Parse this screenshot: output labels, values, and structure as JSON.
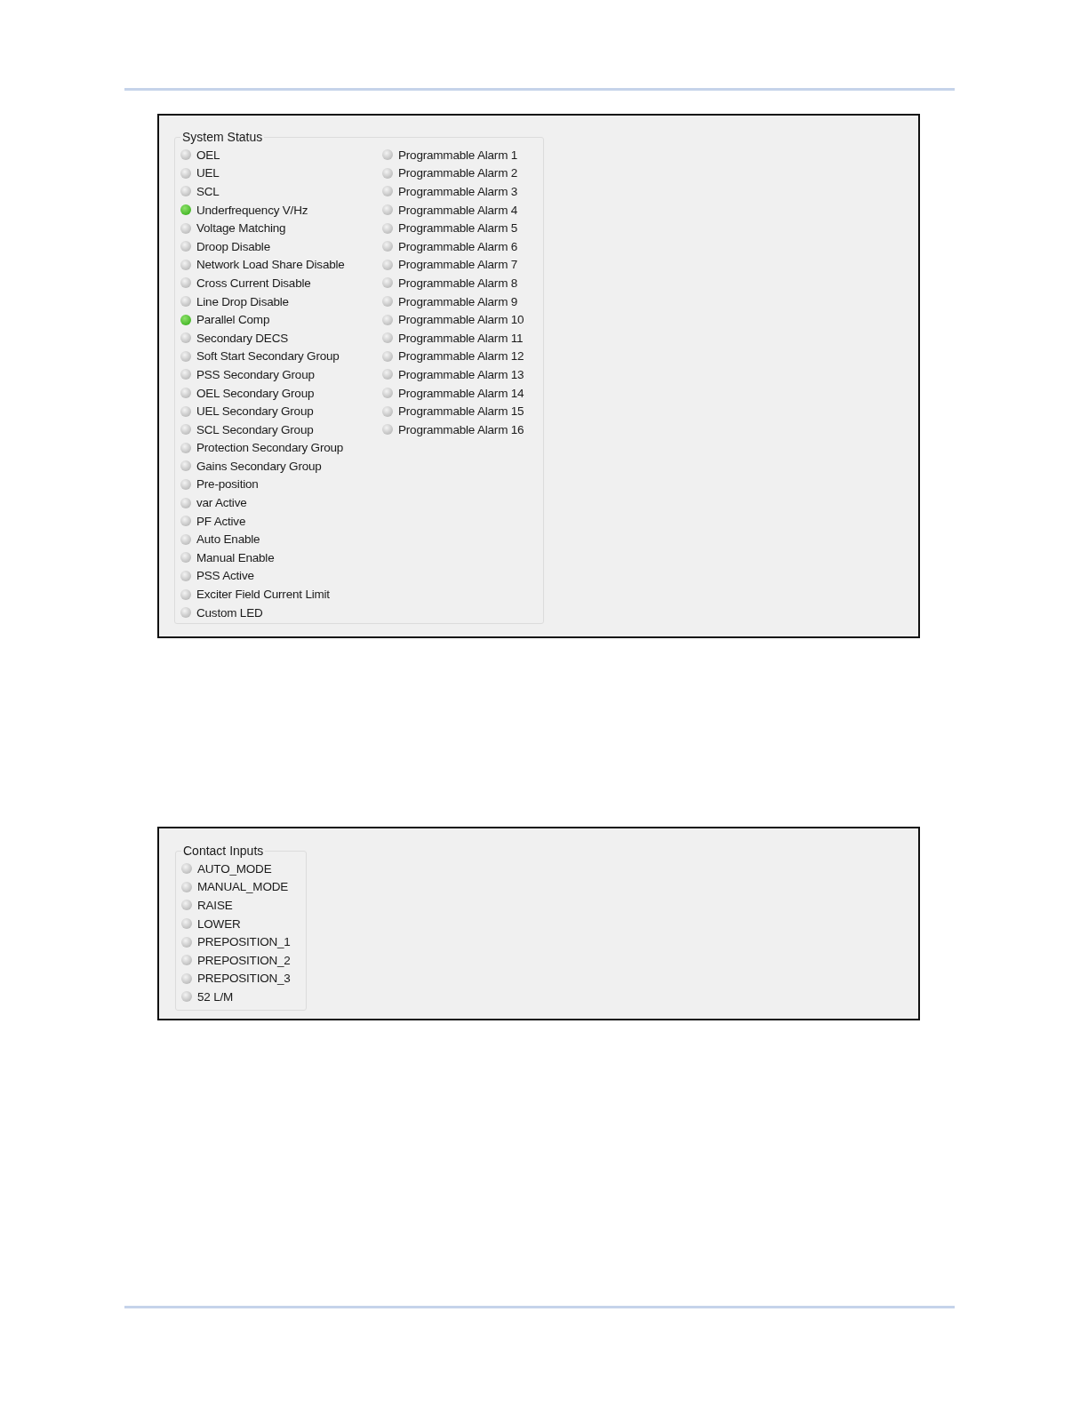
{
  "system_status": {
    "title": "System Status",
    "columns": [
      [
        {
          "label": "OEL",
          "on": false
        },
        {
          "label": "UEL",
          "on": false
        },
        {
          "label": "SCL",
          "on": false
        },
        {
          "label": "Underfrequency V/Hz",
          "on": true
        },
        {
          "label": "Voltage Matching",
          "on": false
        },
        {
          "label": "Droop Disable",
          "on": false
        },
        {
          "label": "Network Load Share Disable",
          "on": false
        },
        {
          "label": "Cross Current Disable",
          "on": false
        },
        {
          "label": "Line Drop Disable",
          "on": false
        },
        {
          "label": "Parallel Comp",
          "on": true
        },
        {
          "label": "Secondary DECS",
          "on": false
        },
        {
          "label": "Soft Start Secondary Group",
          "on": false
        },
        {
          "label": "PSS Secondary Group",
          "on": false
        },
        {
          "label": "OEL Secondary Group",
          "on": false
        },
        {
          "label": "UEL Secondary Group",
          "on": false
        },
        {
          "label": "SCL Secondary Group",
          "on": false
        },
        {
          "label": "Protection Secondary Group",
          "on": false
        },
        {
          "label": "Gains Secondary Group",
          "on": false
        },
        {
          "label": "Pre-position",
          "on": false
        },
        {
          "label": "var Active",
          "on": false
        },
        {
          "label": "PF Active",
          "on": false
        },
        {
          "label": "Auto Enable",
          "on": false
        },
        {
          "label": "Manual Enable",
          "on": false
        },
        {
          "label": "PSS Active",
          "on": false
        },
        {
          "label": "Exciter Field Current Limit",
          "on": false
        },
        {
          "label": "Custom LED",
          "on": false
        }
      ],
      [
        {
          "label": "Programmable Alarm 1",
          "on": false
        },
        {
          "label": "Programmable Alarm 2",
          "on": false
        },
        {
          "label": "Programmable Alarm 3",
          "on": false
        },
        {
          "label": "Programmable Alarm 4",
          "on": false
        },
        {
          "label": "Programmable Alarm 5",
          "on": false
        },
        {
          "label": "Programmable Alarm 6",
          "on": false
        },
        {
          "label": "Programmable Alarm 7",
          "on": false
        },
        {
          "label": "Programmable Alarm 8",
          "on": false
        },
        {
          "label": "Programmable Alarm 9",
          "on": false
        },
        {
          "label": "Programmable Alarm 10",
          "on": false
        },
        {
          "label": "Programmable Alarm 11",
          "on": false
        },
        {
          "label": "Programmable Alarm 12",
          "on": false
        },
        {
          "label": "Programmable Alarm 13",
          "on": false
        },
        {
          "label": "Programmable Alarm 14",
          "on": false
        },
        {
          "label": "Programmable Alarm 15",
          "on": false
        },
        {
          "label": "Programmable Alarm 16",
          "on": false
        }
      ]
    ]
  },
  "contact_inputs": {
    "title": "Contact Inputs",
    "items": [
      {
        "label": "AUTO_MODE",
        "on": false
      },
      {
        "label": "MANUAL_MODE",
        "on": false
      },
      {
        "label": "RAISE",
        "on": false
      },
      {
        "label": "LOWER",
        "on": false
      },
      {
        "label": "PREPOSITION_1",
        "on": false
      },
      {
        "label": "PREPOSITION_2",
        "on": false
      },
      {
        "label": "PREPOSITION_3",
        "on": false
      },
      {
        "label": "52 L/M",
        "on": false
      }
    ]
  }
}
